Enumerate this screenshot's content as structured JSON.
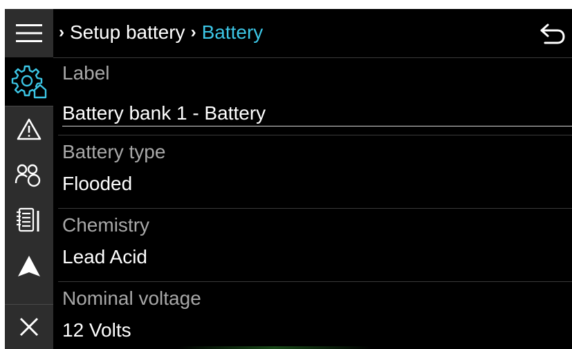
{
  "sidebar": {
    "items": [
      {
        "icon": "menu-icon"
      },
      {
        "icon": "settings-home-icon",
        "active": true
      },
      {
        "icon": "warning-icon"
      },
      {
        "icon": "users-icon"
      },
      {
        "icon": "notebook-icon"
      },
      {
        "icon": "navigation-icon"
      },
      {
        "icon": "close-icon"
      }
    ]
  },
  "header": {
    "breadcrumb_parent": "Setup battery",
    "breadcrumb_current": "Battery",
    "back_icon": "back-arrow-icon"
  },
  "settings": [
    {
      "label": "Label",
      "value": "Battery bank 1 - Battery",
      "editable": true
    },
    {
      "label": "Battery type",
      "value": "Flooded"
    },
    {
      "label": "Chemistry",
      "value": "Lead Acid"
    },
    {
      "label": "Nominal voltage",
      "value": "12 Volts"
    }
  ],
  "colors": {
    "background": "#000000",
    "sidebar": "#2d2d2d",
    "accent": "#3cc6e6",
    "label": "#a8a8a8",
    "text": "#ffffff"
  }
}
